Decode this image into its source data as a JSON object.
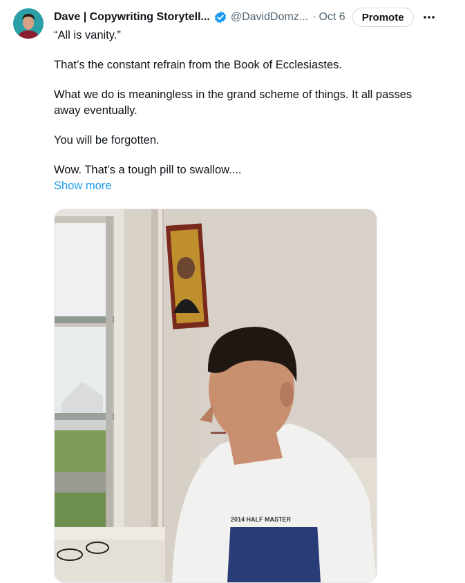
{
  "author": {
    "name": "Dave | Copywriting Storytell...",
    "handle": "@DavidDomz...",
    "separator": "·",
    "date": "Oct 6",
    "avatar_icon": "user-avatar"
  },
  "actions": {
    "promote_label": "Promote",
    "more_icon": "ellipsis-icon"
  },
  "tweet": {
    "paragraphs": [
      "“All is vanity.”",
      "That’s the constant refrain from the Book of Ecclesiastes.",
      "What we do is meaningless in the grand scheme of things. It all passes away eventually.",
      "You will be forgotten.",
      "Wow. That’s a tough pill to swallow...."
    ],
    "show_more": "Show more"
  },
  "media": {
    "shirt_text": "2014 HALF MASTER"
  },
  "colors": {
    "accent": "#1d9bf0",
    "text": "#0f1419",
    "muted": "#536471",
    "verified": "#1d9bf0"
  }
}
